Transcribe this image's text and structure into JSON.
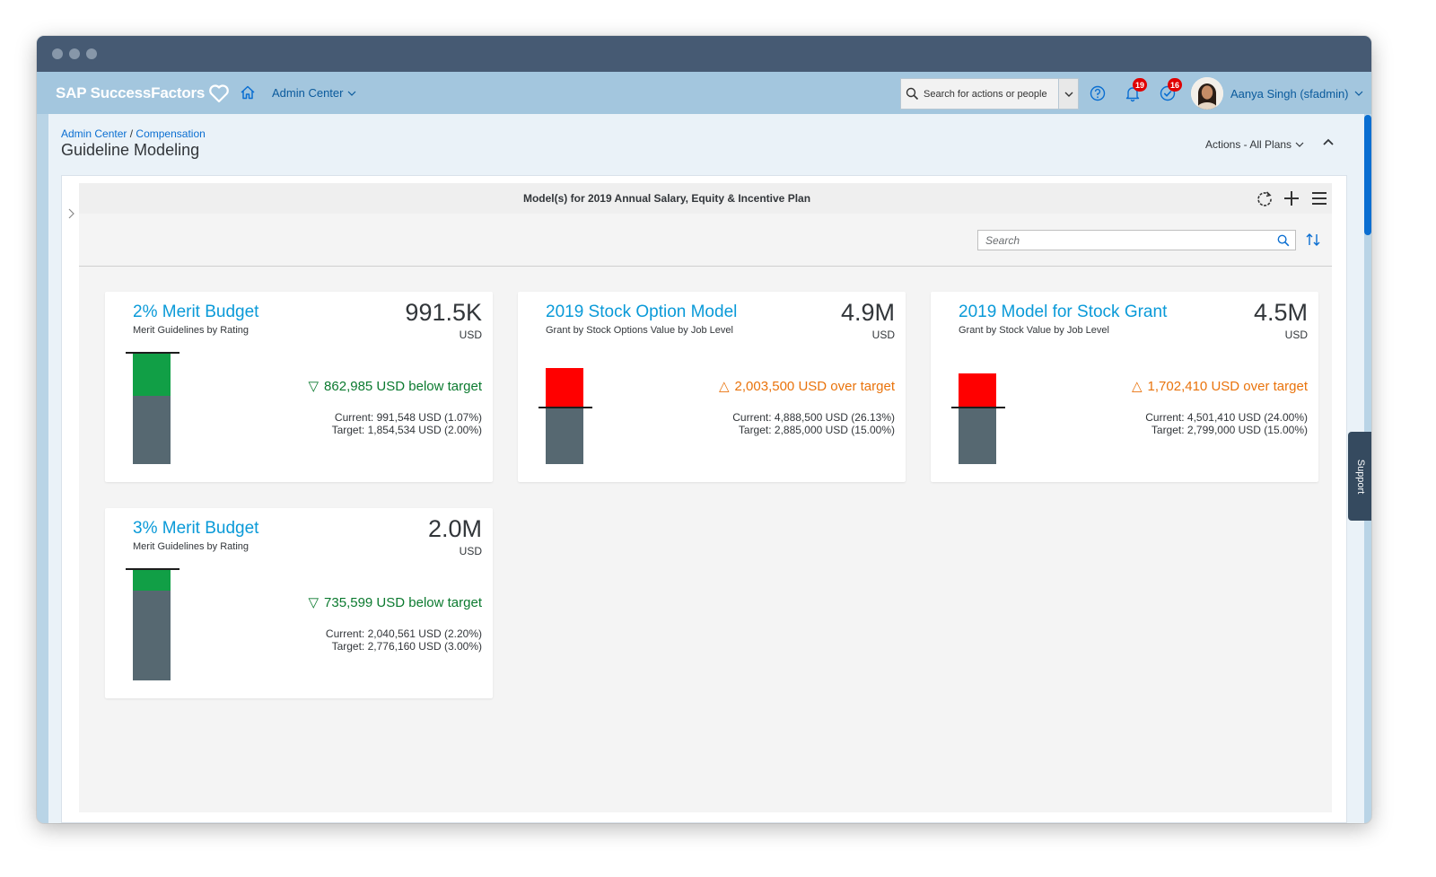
{
  "colors": {
    "brand_link": "#0a6ed1",
    "card_title": "#0a9ad8",
    "below_target": "#0b7a2f",
    "over_target": "#e9730c",
    "bar_base": "#566871",
    "bar_good": "#119f46",
    "bar_bad": "#ff0000",
    "shellbar": "#a3c6de",
    "titlebar": "#465a73"
  },
  "shell": {
    "brand": "SAP SuccessFactors",
    "brand_icon": "heart-icon",
    "home_icon": "home-icon",
    "admin_menu": "Admin Center",
    "search_placeholder": "Search for actions or people",
    "help_icon": "help-icon",
    "notifications": {
      "icon": "bell-icon",
      "count": "19"
    },
    "todos": {
      "icon": "todo-check-icon",
      "count": "16"
    },
    "user_name": "Aanya Singh (sfadmin)"
  },
  "page": {
    "breadcrumb": {
      "root": "Admin Center",
      "separator": "/",
      "current": "Compensation"
    },
    "title": "Guideline Modeling",
    "actions_menu": "Actions - All Plans"
  },
  "panel": {
    "title": "Model(s) for 2019 Annual Salary, Equity & Incentive Plan",
    "search_placeholder": "Search",
    "tools": [
      "refresh-icon",
      "add-icon",
      "menu-icon"
    ]
  },
  "cards": [
    {
      "title": "2% Merit Budget",
      "subtitle": "Merit Guidelines by Rating",
      "value": "991.5K",
      "unit": "USD",
      "status": "below",
      "status_symbol": "▽",
      "status_text": "862,985 USD below target",
      "current": "Current: 991,548 USD (1.07%)",
      "target": "Target: 1,854,534 USD (2.00%)",
      "bar": {
        "current_value": 991548,
        "target_value": 1854534
      }
    },
    {
      "title": "2019 Stock Option Model",
      "subtitle": "Grant by Stock Options Value by Job Level",
      "value": "4.9M",
      "unit": "USD",
      "status": "over",
      "status_symbol": "△",
      "status_text": "2,003,500 USD over target",
      "current": "Current: 4,888,500 USD (26.13%)",
      "target": "Target: 2,885,000 USD (15.00%)",
      "bar": {
        "current_value": 4888500,
        "target_value": 2885000
      }
    },
    {
      "title": "2019 Model for Stock Grant",
      "subtitle": "Grant by Stock Value by Job Level",
      "value": "4.5M",
      "unit": "USD",
      "status": "over",
      "status_symbol": "△",
      "status_text": "1,702,410 USD over target",
      "current": "Current: 4,501,410 USD (24.00%)",
      "target": "Target: 2,799,000 USD (15.00%)",
      "bar": {
        "current_value": 4501410,
        "target_value": 2799000
      }
    },
    {
      "title": "3% Merit Budget",
      "subtitle": "Merit Guidelines by Rating",
      "value": "2.0M",
      "unit": "USD",
      "status": "below",
      "status_symbol": "▽",
      "status_text": "735,599 USD below target",
      "current": "Current: 2,040,561 USD (2.20%)",
      "target": "Target: 2,776,160 USD (3.00%)",
      "bar": {
        "current_value": 2040561,
        "target_value": 2776160
      }
    }
  ],
  "support": "Support"
}
